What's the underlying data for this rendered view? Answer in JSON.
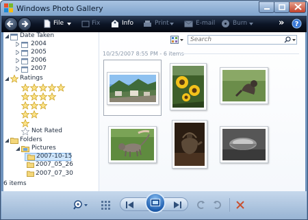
{
  "window": {
    "title": "Windows Photo Gallery"
  },
  "toolbar": {
    "file": "File",
    "fix": "Fix",
    "info": "Info",
    "print": "Print",
    "email": "E-mail",
    "burn": "Burn",
    "overflow": "»"
  },
  "search": {
    "placeholder": "Search"
  },
  "nav": {
    "date_taken": "Date Taken",
    "years": [
      "2004",
      "2005",
      "2006",
      "2007"
    ],
    "ratings": "Ratings",
    "not_rated": "Not Rated",
    "folders": "Folders",
    "pictures": "Pictures",
    "subfolders": [
      "2007-10-15",
      "2007_05_26",
      "2007_07_30"
    ]
  },
  "group_header": "10/25/2007 8:55 PM - 6 items",
  "thumbnails": [
    "mountain-village",
    "sunflowers",
    "cat-on-grass",
    "cat-walking",
    "teapot",
    "bowl"
  ],
  "status": {
    "count": "6 items"
  },
  "colors": {
    "toolbar_bg": "#0c1526",
    "selection": "#cde4fb",
    "star": "#f5c518",
    "accent": "#2f7fd6"
  }
}
